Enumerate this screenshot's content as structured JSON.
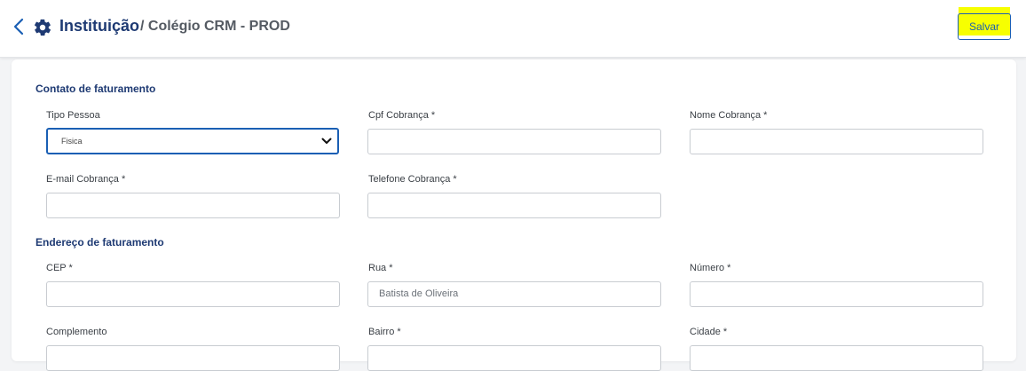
{
  "header": {
    "title": "Instituição",
    "subtitle": "/ Colégio CRM - PROD",
    "save_label": "Salvar",
    "icons": [
      "chevron-left-icon",
      "gear-icon"
    ]
  },
  "colors": {
    "primary": "#1a5fb4",
    "heading": "#1e3a73",
    "highlight": "#f7ff00"
  },
  "sections": {
    "billing_contact": "Contato de faturamento",
    "billing_address": "Endereço de faturamento"
  },
  "fields": {
    "tipo_pessoa": {
      "label": "Tipo Pessoa",
      "value": "Fisica"
    },
    "cpf": {
      "label": "Cpf Cobrança *",
      "value": ""
    },
    "nome": {
      "label": "Nome Cobrança *",
      "value": ""
    },
    "email": {
      "label": "E-mail Cobrança *",
      "value": ""
    },
    "telefone": {
      "label": "Telefone Cobrança *",
      "value": ""
    },
    "cep": {
      "label": "CEP *",
      "value": ""
    },
    "rua": {
      "label": "Rua *",
      "value": "Batista de Oliveira"
    },
    "numero": {
      "label": "Número *",
      "value": ""
    },
    "complemento": {
      "label": "Complemento",
      "value": ""
    },
    "bairro": {
      "label": "Bairro *",
      "value": ""
    },
    "cidade": {
      "label": "Cidade *",
      "value": ""
    }
  }
}
